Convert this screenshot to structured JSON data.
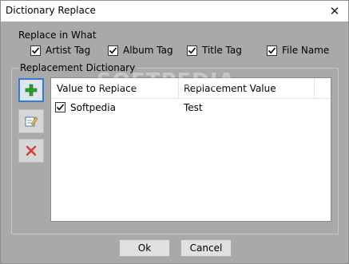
{
  "window": {
    "title": "Dictionary Replace",
    "close_glyph": "✕"
  },
  "replace_in": {
    "label": "Replace in What",
    "options": [
      {
        "label": "Artist Tag",
        "checked": true
      },
      {
        "label": "Album Tag",
        "checked": true
      },
      {
        "label": "Title Tag",
        "checked": true
      },
      {
        "label": "File Name",
        "checked": true
      }
    ]
  },
  "dictionary": {
    "label": "Replacement Dictionary",
    "toolbar": [
      {
        "icon": "add-icon"
      },
      {
        "icon": "edit-icon"
      },
      {
        "icon": "delete-icon"
      }
    ],
    "columns": [
      "Value to Replace",
      "Replacement Value"
    ],
    "rows": [
      {
        "value": "Softpedia",
        "replacement": "Test",
        "checked": true
      }
    ]
  },
  "watermark": "SOFTPEDIA",
  "buttons": {
    "ok": "Ok",
    "cancel": "Cancel"
  },
  "colors": {
    "client_bg": "#a9a9a9",
    "accent": "#3a78d4",
    "add_green": "#2e9e2e",
    "delete_red": "#d43a3a"
  }
}
